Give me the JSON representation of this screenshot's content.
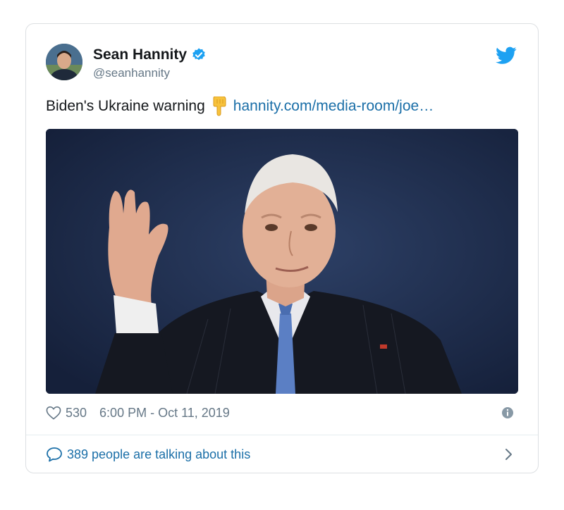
{
  "tweet": {
    "author_name": "Sean Hannity",
    "author_handle": "@seanhannity",
    "text": "Biden's Ukraine warning",
    "link_text": "hannity.com/media-room/joe…",
    "like_count": "530",
    "timestamp": "6:00 PM - Oct 11, 2019",
    "talking_text": "389 people are talking about this"
  },
  "colors": {
    "link": "#1b6fa8",
    "verified": "#1da1f2",
    "twitter_blue": "#1da1f2",
    "muted": "#657786"
  },
  "icons": {
    "verified": "verified-badge-icon",
    "bird": "twitter-bird-icon",
    "emoji": "backhand-index-pointing-down-emoji",
    "heart": "heart-icon",
    "info": "info-icon",
    "bubble": "speech-bubble-icon",
    "chevron": "chevron-right-icon"
  }
}
